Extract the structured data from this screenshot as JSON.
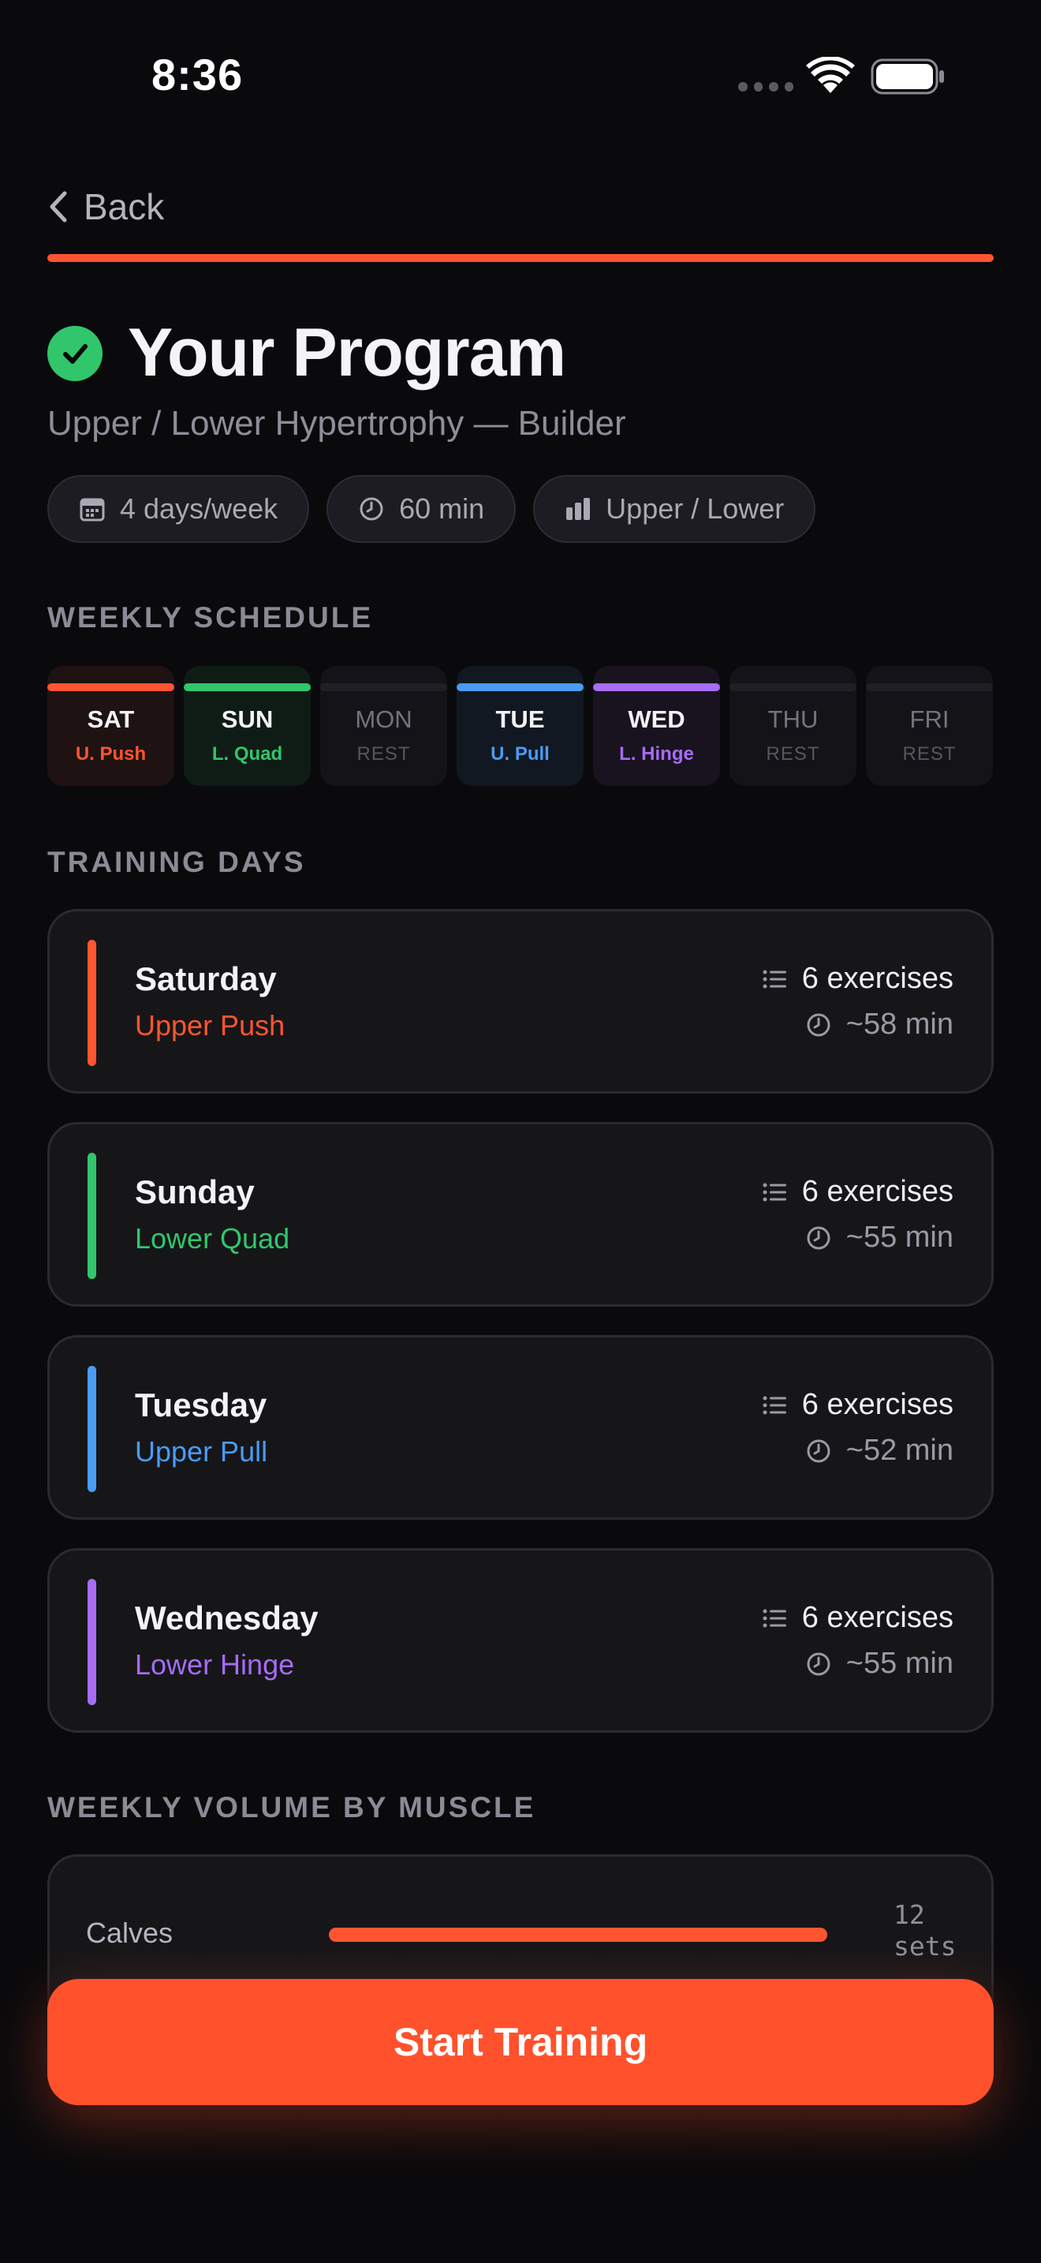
{
  "status": {
    "time": "8:36"
  },
  "nav": {
    "back_label": "Back"
  },
  "header": {
    "title": "Your Program",
    "subtitle": "Upper / Lower Hypertrophy — Builder",
    "chips": [
      {
        "icon": "calendar-icon",
        "label": "4 days/week"
      },
      {
        "icon": "clock-icon",
        "label": "60 min"
      },
      {
        "icon": "bar-chart-icon",
        "label": "Upper / Lower"
      }
    ]
  },
  "colors": {
    "accent": "#ff5530",
    "push": "#ff5530",
    "quad": "#31c66b",
    "pull": "#4a9bf5",
    "hinge": "#a66cf5"
  },
  "weekly_schedule": {
    "label": "WEEKLY SCHEDULE",
    "days": [
      {
        "day": "SAT",
        "tag": "U. Push",
        "color": "#ff5530",
        "bg": "#1f1212",
        "rest": false
      },
      {
        "day": "SUN",
        "tag": "L. Quad",
        "color": "#31c66b",
        "bg": "#0f1c16",
        "rest": false
      },
      {
        "day": "MON",
        "tag": "REST",
        "rest": true
      },
      {
        "day": "TUE",
        "tag": "U. Pull",
        "color": "#4a9bf5",
        "bg": "#111822",
        "rest": false
      },
      {
        "day": "WED",
        "tag": "L. Hinge",
        "color": "#a66cf5",
        "bg": "#18131f",
        "rest": false
      },
      {
        "day": "THU",
        "tag": "REST",
        "rest": true
      },
      {
        "day": "FRI",
        "tag": "REST",
        "rest": true
      }
    ]
  },
  "training_days": {
    "label": "TRAINING DAYS",
    "items": [
      {
        "day": "Saturday",
        "focus": "Upper Push",
        "color": "#ff5530",
        "exercises": "6 exercises",
        "duration": "~58 min"
      },
      {
        "day": "Sunday",
        "focus": "Lower Quad",
        "color": "#31c66b",
        "exercises": "6 exercises",
        "duration": "~55 min"
      },
      {
        "day": "Tuesday",
        "focus": "Upper Pull",
        "color": "#4a9bf5",
        "exercises": "6 exercises",
        "duration": "~52 min"
      },
      {
        "day": "Wednesday",
        "focus": "Lower Hinge",
        "color": "#a66cf5",
        "exercises": "6 exercises",
        "duration": "~55 min"
      }
    ]
  },
  "weekly_volume": {
    "label": "WEEKLY VOLUME BY MUSCLE",
    "rows": [
      {
        "muscle": "Calves",
        "value_line1": "12",
        "value_line2": "sets",
        "fill_fraction": 1.0
      }
    ]
  },
  "cta": {
    "label": "Start Training"
  }
}
